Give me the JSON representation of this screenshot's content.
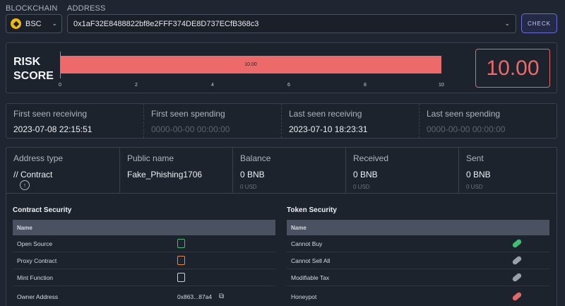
{
  "header": {
    "blockchain_label": "BLOCKCHAIN",
    "address_label": "ADDRESS",
    "chain_value": "BSC",
    "chain_icon": "bnb-coin-icon",
    "address_value": "0x1aF32E8488822bf8e2FFF374DE8D737ECfB368c3",
    "check_label": "CHECK"
  },
  "risk": {
    "title_line1": "RISK",
    "title_line2": "SCORE",
    "score": "10.00",
    "bar_value": 10,
    "bar_max": 10,
    "bar_label": "10.00",
    "ticks": [
      "0",
      "2",
      "4",
      "6",
      "8",
      "10"
    ],
    "color": "#ec6a6a"
  },
  "seen": [
    {
      "label": "First seen receiving",
      "value": "2023-07-08 22:15:51",
      "empty": false
    },
    {
      "label": "First seen spending",
      "value": "0000-00-00 00:00:00",
      "empty": true
    },
    {
      "label": "Last seen receiving",
      "value": "2023-07-10 18:23:31",
      "empty": false
    },
    {
      "label": "Last seen spending",
      "value": "0000-00-00 00:00:00",
      "empty": true
    }
  ],
  "info": {
    "address_type": {
      "label": "Address type",
      "value": "// Contract"
    },
    "public_name": {
      "label": "Public name",
      "value": "Fake_Phishing1706"
    },
    "balance": {
      "label": "Balance",
      "value": "0 BNB",
      "sub": "0 USD"
    },
    "received": {
      "label": "Received",
      "value": "0 BNB",
      "sub": "0 USD"
    },
    "sent": {
      "label": "Sent",
      "value": "0 BNB",
      "sub": "0 USD"
    }
  },
  "contract_security": {
    "title": "Contract Security",
    "header": "Name",
    "rows": [
      {
        "name": "Open Source",
        "status": "doc-ok-icon",
        "color": "#3fbf72"
      },
      {
        "name": "Proxy Contract",
        "status": "doc-warn-icon",
        "color": "#e8893a"
      },
      {
        "name": "Mint Function",
        "status": "doc-neutral-icon",
        "color": "#c9ced6"
      },
      {
        "name": "Owner Address",
        "value": "0x863...87a4",
        "status": "copy-icon"
      }
    ]
  },
  "token_security": {
    "title": "Token Security",
    "header": "Name",
    "rows": [
      {
        "name": "Cannot Buy",
        "status": "pill-ok-icon",
        "color": "#3fbf72"
      },
      {
        "name": "Cannot Sell All",
        "status": "pill-neutral-icon",
        "color": "#9aa0aa"
      },
      {
        "name": "Modifiable Tax",
        "status": "pill-neutral-icon",
        "color": "#9aa0aa"
      },
      {
        "name": "Honeypot",
        "status": "pill-danger-icon",
        "color": "#e06a6a"
      }
    ]
  }
}
